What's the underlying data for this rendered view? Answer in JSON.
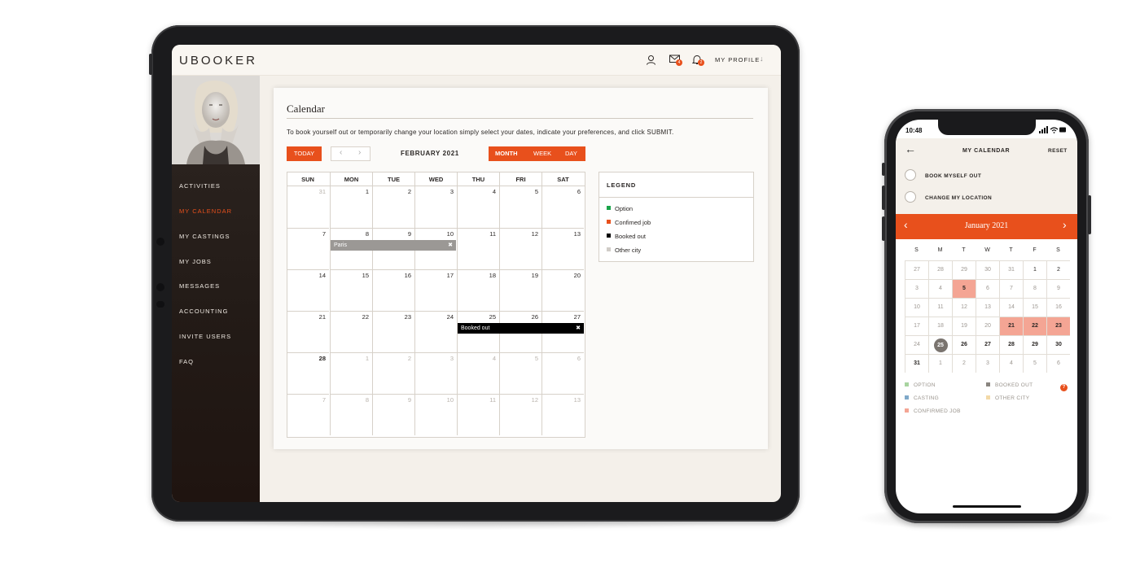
{
  "tablet": {
    "brand": "UBOOKER",
    "header": {
      "profile_label": "MY PROFILE",
      "messages_badge": "4",
      "notifications_badge": "2"
    },
    "sidebar": {
      "items": [
        {
          "label": "ACTIVITIES",
          "active": false
        },
        {
          "label": "MY CALENDAR",
          "active": true
        },
        {
          "label": "MY CASTINGS",
          "active": false
        },
        {
          "label": "MY JOBS",
          "active": false
        },
        {
          "label": "MESSAGES",
          "active": false
        },
        {
          "label": "ACCOUNTING",
          "active": false
        },
        {
          "label": "INVITE USERS",
          "active": false
        },
        {
          "label": "FAQ",
          "active": false
        }
      ]
    },
    "calendar": {
      "title": "Calendar",
      "description": "To book yourself out or temporarily change your location simply select your dates, indicate your preferences, and click SUBMIT.",
      "today_label": "TODAY",
      "prev_icon": "‹",
      "next_icon": "›",
      "month_label": "FEBRUARY 2021",
      "views": [
        "MONTH",
        "WEEK",
        "DAY"
      ],
      "weekdays": [
        "SUN",
        "MON",
        "TUE",
        "WED",
        "THU",
        "FRI",
        "SAT"
      ],
      "weeks": [
        [
          "31",
          "1",
          "2",
          "3",
          "4",
          "5",
          "6"
        ],
        [
          "7",
          "8",
          "9",
          "10",
          "11",
          "12",
          "13"
        ],
        [
          "14",
          "15",
          "16",
          "17",
          "18",
          "19",
          "20"
        ],
        [
          "21",
          "22",
          "23",
          "24",
          "25",
          "26",
          "27"
        ],
        [
          "28",
          "1",
          "2",
          "3",
          "4",
          "5",
          "6"
        ],
        [
          "7",
          "8",
          "9",
          "10",
          "11",
          "12",
          "13"
        ]
      ],
      "events": [
        {
          "label": "Paris",
          "close": "✖",
          "color": "#9b9895"
        },
        {
          "label": "Booked out",
          "close": "✖",
          "color": "#000000"
        }
      ]
    },
    "legend": {
      "title": "LEGEND",
      "items": [
        {
          "label": "Option",
          "color": "#1aa34a"
        },
        {
          "label": "Confimed job",
          "color": "#e8501c"
        },
        {
          "label": "Booked out",
          "color": "#000000"
        },
        {
          "label": "Other city",
          "color": "#d0ccc7"
        }
      ]
    }
  },
  "phone": {
    "status_time": "10:48",
    "header": {
      "back_icon": "←",
      "title": "MY CALENDAR",
      "reset": "RESET"
    },
    "options": [
      "BOOK MYSELF OUT",
      "CHANGE MY LOCATION"
    ],
    "month_label": "January 2021",
    "prev_icon": "‹",
    "next_icon": "›",
    "weekdays": [
      "S",
      "M",
      "T",
      "W",
      "T",
      "F",
      "S"
    ],
    "weeks": [
      [
        "27",
        "28",
        "29",
        "30",
        "31",
        "1",
        "2"
      ],
      [
        "3",
        "4",
        "5",
        "6",
        "7",
        "8",
        "9"
      ],
      [
        "10",
        "11",
        "12",
        "13",
        "14",
        "15",
        "16"
      ],
      [
        "17",
        "18",
        "19",
        "20",
        "21",
        "22",
        "23"
      ],
      [
        "24",
        "25",
        "26",
        "27",
        "28",
        "29",
        "30"
      ],
      [
        "31",
        "1",
        "2",
        "3",
        "4",
        "5",
        "6"
      ]
    ],
    "legend": [
      {
        "label": "OPTION",
        "color": "#a8d4a0"
      },
      {
        "label": "BOOKED OUT",
        "color": "#8a8580"
      },
      {
        "label": "CASTING",
        "color": "#7fa9c9"
      },
      {
        "label": "OTHER CITY",
        "color": "#f3d9a8"
      },
      {
        "label": "CONFIRMED JOB",
        "color": "#f4a594"
      }
    ],
    "help_badge": "?",
    "accent_color": "#e8501c"
  }
}
